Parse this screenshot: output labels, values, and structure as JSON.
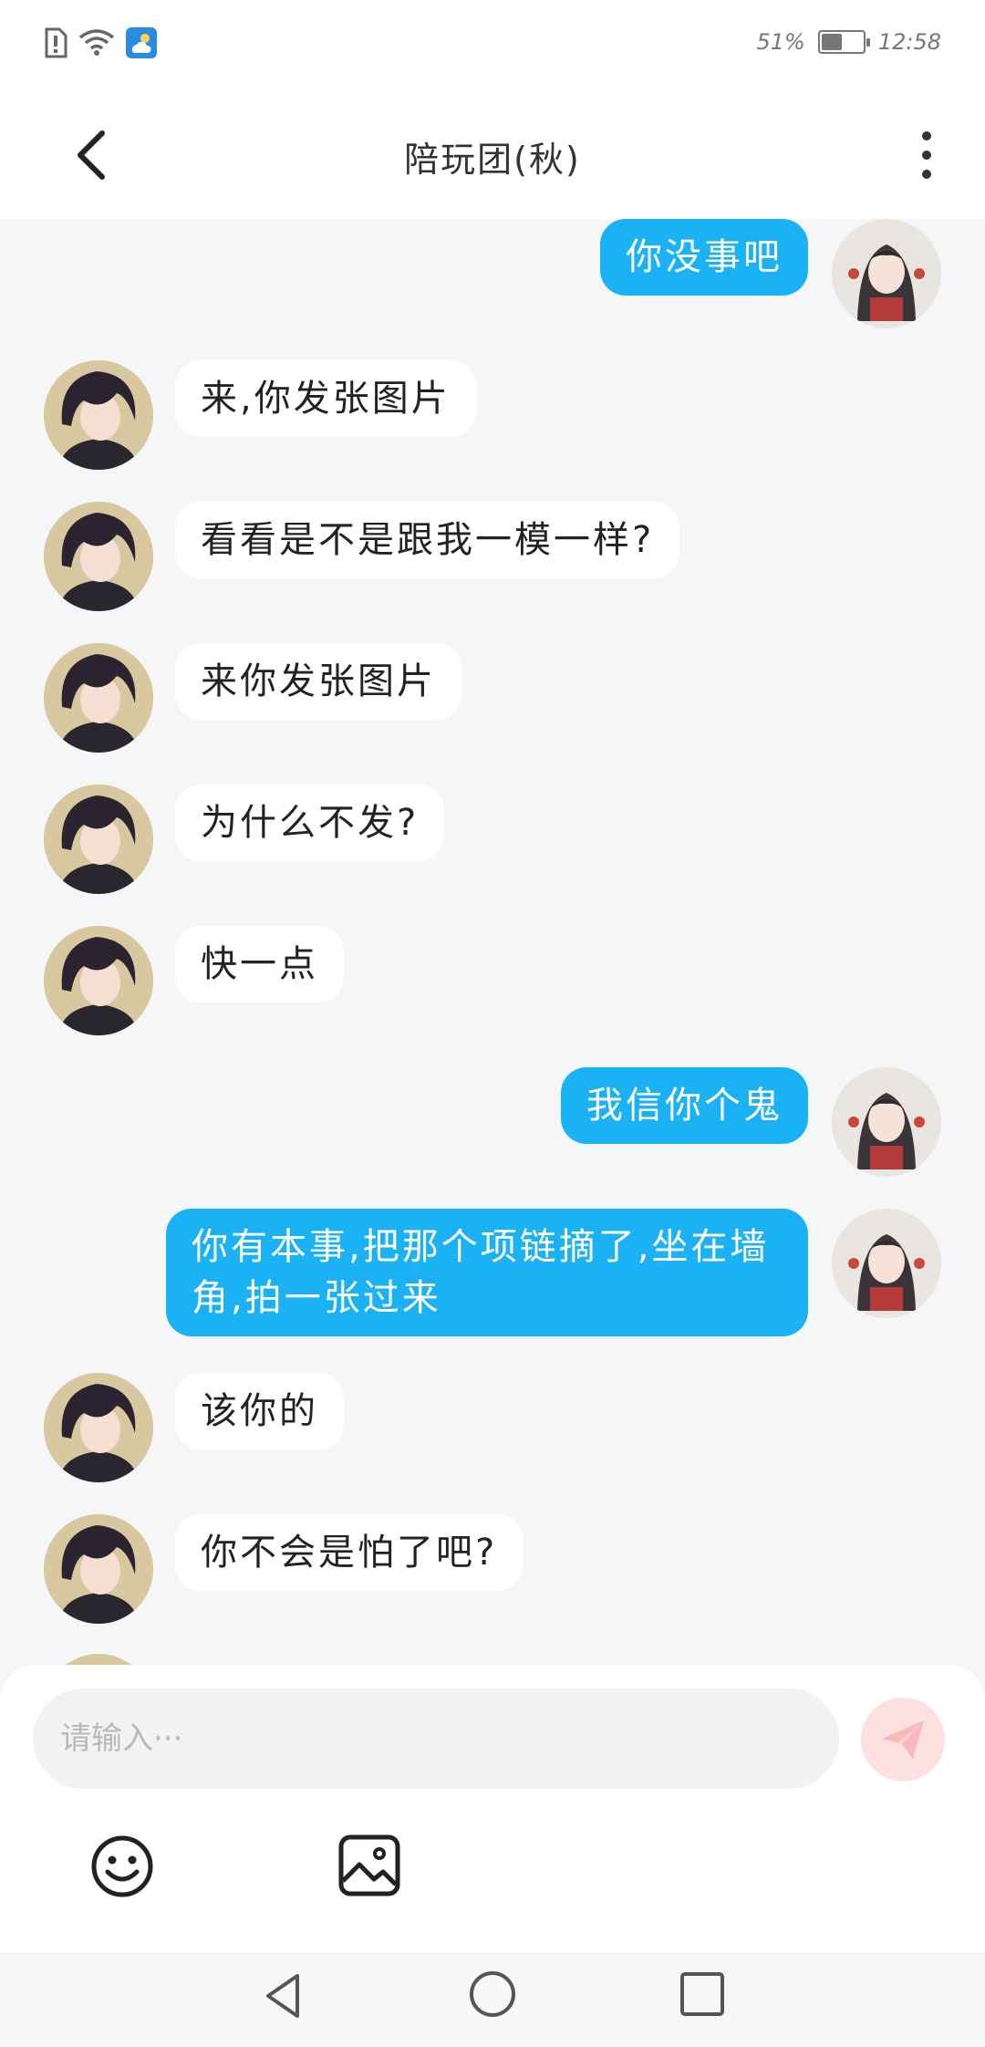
{
  "status_bar": {
    "battery_text": "51%",
    "battery_level": 0.51,
    "time": "12:58",
    "icons": [
      "sim-alert-icon",
      "wifi-icon",
      "weather-icon"
    ]
  },
  "header": {
    "title": "陪玩团(秋)",
    "back_icon": "chevron-left-icon",
    "more_icon": "more-vertical-icon"
  },
  "messages": [
    {
      "side": "out",
      "text": "你没事吧"
    },
    {
      "side": "in",
      "text": "来,你发张图片"
    },
    {
      "side": "in",
      "text": "看看是不是跟我一模一样?"
    },
    {
      "side": "in",
      "text": "来你发张图片"
    },
    {
      "side": "in",
      "text": "为什么不发?"
    },
    {
      "side": "in",
      "text": "快一点"
    },
    {
      "side": "out",
      "text": "我信你个鬼"
    },
    {
      "side": "out",
      "text": "你有本事,把那个项链摘了,坐在墙角,拍一张过来"
    },
    {
      "side": "in",
      "text": "该你的"
    },
    {
      "side": "in",
      "text": "你不会是怕了吧?"
    }
  ],
  "composer": {
    "placeholder": "请输入···",
    "send_icon": "paper-plane-icon",
    "emoji_icon": "smiley-icon",
    "image_icon": "image-icon",
    "send_color": "#fde1e1"
  },
  "colors": {
    "outgoing_bubble": "#1ab2f5",
    "incoming_bubble": "#ffffff",
    "background": "#f5f6f8"
  },
  "navbar": {
    "icons": [
      "nav-back-icon",
      "nav-home-icon",
      "nav-recents-icon"
    ]
  }
}
